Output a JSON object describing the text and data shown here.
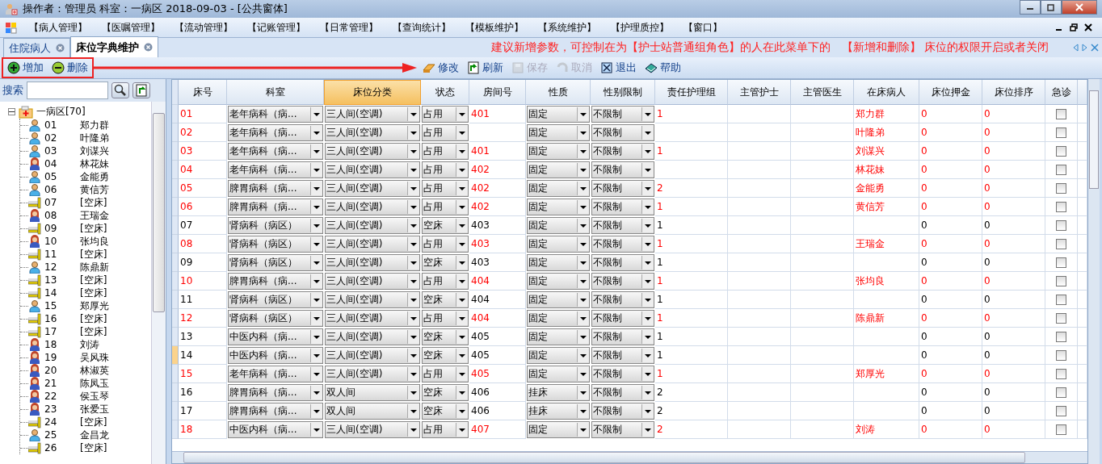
{
  "window": {
    "title": "操作者：管理员  科室：一病区  2018-09-03 - [公共窗体]"
  },
  "menu": [
    "【病人管理】",
    "【医嘱管理】",
    "【流动管理】",
    "【记账管理】",
    "【日常管理】",
    "【查询统计】",
    "【模板维护】",
    "【系统维护】",
    "【护理质控】",
    "【窗口】"
  ],
  "tabs": [
    {
      "label": "住院病人",
      "selected": false
    },
    {
      "label": "床位字典维护",
      "selected": true
    }
  ],
  "annotation": "建议新增参数，可控制在为【护士站普通组角色】的人在此菜单下的　【新增和删除】 床位的权限开启或者关闭",
  "toolbar": {
    "framed_buttons": [
      {
        "label": "增加",
        "kind": "add",
        "disabled": false
      },
      {
        "label": "删除",
        "kind": "delete",
        "disabled": false
      }
    ],
    "buttons": [
      {
        "label": "修改",
        "kind": "edit",
        "disabled": false
      },
      {
        "label": "刷新",
        "kind": "refresh",
        "disabled": false
      },
      {
        "label": "保存",
        "kind": "save",
        "disabled": true
      },
      {
        "label": "取消",
        "kind": "undo",
        "disabled": true
      },
      {
        "label": "退出",
        "kind": "exit",
        "disabled": false
      },
      {
        "label": "帮助",
        "kind": "help",
        "disabled": false
      }
    ]
  },
  "sidebar": {
    "search_label": "搜索",
    "tree": {
      "label": "一病区[70]",
      "expanded": true,
      "children": [
        {
          "bed": "01",
          "name": "郑力群",
          "kind": "male"
        },
        {
          "bed": "02",
          "name": "叶隆弟",
          "kind": "male"
        },
        {
          "bed": "03",
          "name": "刘谋兴",
          "kind": "male"
        },
        {
          "bed": "04",
          "name": "林花妹",
          "kind": "female"
        },
        {
          "bed": "05",
          "name": "金能勇",
          "kind": "male"
        },
        {
          "bed": "06",
          "name": "黄信芳",
          "kind": "male"
        },
        {
          "bed": "07",
          "name": "[空床]",
          "kind": "empty"
        },
        {
          "bed": "08",
          "name": "王瑞金",
          "kind": "female"
        },
        {
          "bed": "09",
          "name": "[空床]",
          "kind": "empty"
        },
        {
          "bed": "10",
          "name": "张均良",
          "kind": "female"
        },
        {
          "bed": "11",
          "name": "[空床]",
          "kind": "empty"
        },
        {
          "bed": "12",
          "name": "陈鼎新",
          "kind": "male"
        },
        {
          "bed": "13",
          "name": "[空床]",
          "kind": "empty"
        },
        {
          "bed": "14",
          "name": "[空床]",
          "kind": "empty"
        },
        {
          "bed": "15",
          "name": "郑厚光",
          "kind": "male"
        },
        {
          "bed": "16",
          "name": "[空床]",
          "kind": "empty"
        },
        {
          "bed": "17",
          "name": "[空床]",
          "kind": "empty"
        },
        {
          "bed": "18",
          "name": "刘涛",
          "kind": "female"
        },
        {
          "bed": "19",
          "name": "吴风珠",
          "kind": "female"
        },
        {
          "bed": "20",
          "name": "林淑英",
          "kind": "female"
        },
        {
          "bed": "21",
          "name": "陈凤玉",
          "kind": "female"
        },
        {
          "bed": "22",
          "name": "侯玉琴",
          "kind": "female"
        },
        {
          "bed": "23",
          "name": "张爱玉",
          "kind": "female"
        },
        {
          "bed": "24",
          "name": "[空床]",
          "kind": "empty"
        },
        {
          "bed": "25",
          "name": "金昌龙",
          "kind": "male"
        },
        {
          "bed": "26",
          "name": "[空床]",
          "kind": "empty"
        }
      ]
    }
  },
  "table": {
    "columns": [
      {
        "label": "床号",
        "selected": false
      },
      {
        "label": "科室",
        "selected": false
      },
      {
        "label": "床位分类",
        "selected": true
      },
      {
        "label": "状态",
        "selected": false
      },
      {
        "label": "房间号",
        "selected": false
      },
      {
        "label": "性质",
        "selected": false
      },
      {
        "label": "性别限制",
        "selected": false
      },
      {
        "label": "责任护理组",
        "selected": false
      },
      {
        "label": "主管护士",
        "selected": false
      },
      {
        "label": "主管医生",
        "selected": false
      },
      {
        "label": "在床病人",
        "selected": false
      },
      {
        "label": "床位押金",
        "selected": false
      },
      {
        "label": "床位排序",
        "selected": false
      },
      {
        "label": "急诊",
        "selected": false
      }
    ],
    "rows": [
      {
        "bed": "01",
        "dept": "老年病科（病...",
        "type": "三人间(空调)",
        "status": "占用",
        "room": "401",
        "nature": "固定",
        "gender": "不限制",
        "group": "1",
        "patient": "郑力群",
        "deposit": "0",
        "order": "0",
        "urgent": false,
        "occupied": true,
        "selected": false
      },
      {
        "bed": "02",
        "dept": "老年病科（病...",
        "type": "三人间(空调)",
        "status": "占用",
        "nature": "固定",
        "gender": "不限制",
        "patient": "叶隆弟",
        "deposit": "0",
        "order": "0",
        "urgent": false,
        "occupied": true,
        "selected": false
      },
      {
        "bed": "03",
        "dept": "老年病科（病...",
        "type": "三人间(空调)",
        "status": "占用",
        "room": "401",
        "nature": "固定",
        "gender": "不限制",
        "group": "1",
        "patient": "刘谋兴",
        "deposit": "0",
        "order": "0",
        "urgent": false,
        "occupied": true,
        "selected": false
      },
      {
        "bed": "04",
        "dept": "老年病科（病...",
        "type": "三人间(空调)",
        "status": "占用",
        "room": "402",
        "nature": "固定",
        "gender": "不限制",
        "patient": "林花妹",
        "deposit": "0",
        "order": "0",
        "urgent": false,
        "occupied": true,
        "selected": false
      },
      {
        "bed": "05",
        "dept": "脾胃病科（病...",
        "type": "三人间(空调)",
        "status": "占用",
        "room": "402",
        "nature": "固定",
        "gender": "不限制",
        "group": "2",
        "patient": "金能勇",
        "deposit": "0",
        "order": "0",
        "urgent": false,
        "occupied": true,
        "selected": false
      },
      {
        "bed": "06",
        "dept": "脾胃病科（病...",
        "type": "三人间(空调)",
        "status": "占用",
        "room": "402",
        "nature": "固定",
        "gender": "不限制",
        "group": "1",
        "patient": "黄信芳",
        "deposit": "0",
        "order": "0",
        "urgent": false,
        "occupied": true,
        "selected": false
      },
      {
        "bed": "07",
        "dept": "肾病科（病区）",
        "type": "三人间(空调)",
        "status": "空床",
        "room": "403",
        "nature": "固定",
        "gender": "不限制",
        "group": "1",
        "deposit": "0",
        "order": "0",
        "urgent": false,
        "occupied": false,
        "selected": false
      },
      {
        "bed": "08",
        "dept": "肾病科（病区）",
        "type": "三人间(空调)",
        "status": "占用",
        "room": "403",
        "nature": "固定",
        "gender": "不限制",
        "group": "1",
        "patient": "王瑞金",
        "deposit": "0",
        "order": "0",
        "urgent": false,
        "occupied": true,
        "selected": false
      },
      {
        "bed": "09",
        "dept": "肾病科（病区）",
        "type": "三人间(空调)",
        "status": "空床",
        "room": "403",
        "nature": "固定",
        "gender": "不限制",
        "group": "1",
        "deposit": "0",
        "order": "0",
        "urgent": false,
        "occupied": false,
        "selected": false
      },
      {
        "bed": "10",
        "dept": "脾胃病科（病...",
        "type": "三人间(空调)",
        "status": "占用",
        "room": "404",
        "nature": "固定",
        "gender": "不限制",
        "group": "1",
        "patient": "张均良",
        "deposit": "0",
        "order": "0",
        "urgent": false,
        "occupied": true,
        "selected": false
      },
      {
        "bed": "11",
        "dept": "肾病科（病区）",
        "type": "三人间(空调)",
        "status": "空床",
        "room": "404",
        "nature": "固定",
        "gender": "不限制",
        "group": "1",
        "deposit": "0",
        "order": "0",
        "urgent": false,
        "occupied": false,
        "selected": false
      },
      {
        "bed": "12",
        "dept": "肾病科（病区）",
        "type": "三人间(空调)",
        "status": "占用",
        "room": "404",
        "nature": "固定",
        "gender": "不限制",
        "group": "1",
        "patient": "陈鼎新",
        "deposit": "0",
        "order": "0",
        "urgent": false,
        "occupied": true,
        "selected": false
      },
      {
        "bed": "13",
        "dept": "中医内科（病...",
        "type": "三人间(空调)",
        "status": "空床",
        "room": "405",
        "nature": "固定",
        "gender": "不限制",
        "group": "1",
        "deposit": "0",
        "order": "0",
        "urgent": false,
        "occupied": false,
        "selected": false
      },
      {
        "bed": "14",
        "dept": "中医内科（病...",
        "type": "三人间(空调)",
        "status": "空床",
        "room": "405",
        "nature": "固定",
        "gender": "不限制",
        "group": "1",
        "deposit": "0",
        "order": "0",
        "urgent": false,
        "occupied": false,
        "selected": true
      },
      {
        "bed": "15",
        "dept": "老年病科（病...",
        "type": "三人间(空调)",
        "status": "占用",
        "room": "405",
        "nature": "固定",
        "gender": "不限制",
        "group": "1",
        "patient": "郑厚光",
        "deposit": "0",
        "order": "0",
        "urgent": false,
        "occupied": true,
        "selected": false
      },
      {
        "bed": "16",
        "dept": "脾胃病科（病...",
        "type": "双人间",
        "status": "空床",
        "room": "406",
        "nature": "挂床",
        "gender": "不限制",
        "group": "2",
        "deposit": "0",
        "order": "0",
        "urgent": false,
        "occupied": false,
        "selected": false
      },
      {
        "bed": "17",
        "dept": "脾胃病科（病...",
        "type": "双人间",
        "status": "空床",
        "room": "406",
        "nature": "挂床",
        "gender": "不限制",
        "group": "2",
        "deposit": "0",
        "order": "0",
        "urgent": false,
        "occupied": false,
        "selected": false
      },
      {
        "bed": "18",
        "dept": "中医内科（病...",
        "type": "三人间(空调)",
        "status": "占用",
        "room": "407",
        "nature": "固定",
        "gender": "不限制",
        "group": "2",
        "patient": "刘涛",
        "deposit": "0",
        "order": "0",
        "urgent": false,
        "occupied": true,
        "selected": false
      }
    ]
  }
}
